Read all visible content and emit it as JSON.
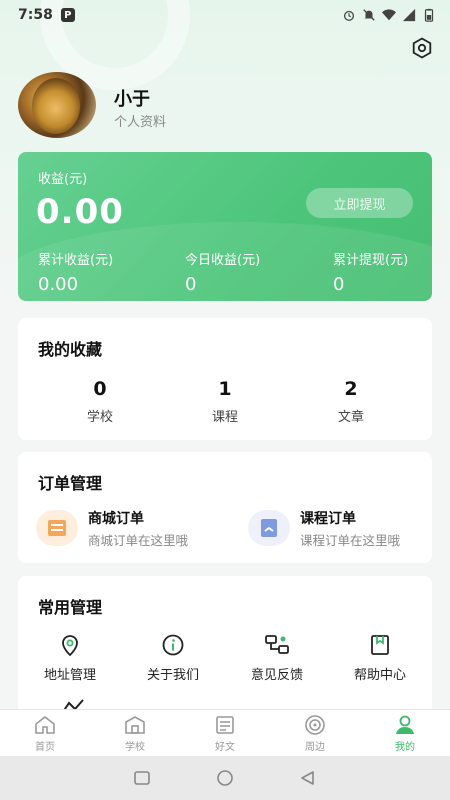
{
  "status_bar": {
    "time": "7:58",
    "app_badge": "P"
  },
  "colors": {
    "accent": "#3dbb6b",
    "card_green": "#4cc57a",
    "order_orange": "#f5a65b",
    "order_blue": "#7f9be0"
  },
  "profile": {
    "name": "小于",
    "subtitle": "个人资料"
  },
  "earnings": {
    "label": "收益(元)",
    "amount": "0.00",
    "withdraw_label": "立即提现",
    "stats": [
      {
        "label": "累计收益(元)",
        "value": "0.00"
      },
      {
        "label": "今日收益(元)",
        "value": "0"
      },
      {
        "label": "累计提现(元)",
        "value": "0"
      }
    ]
  },
  "favorites": {
    "title": "我的收藏",
    "items": [
      {
        "count": "0",
        "label": "学校"
      },
      {
        "count": "1",
        "label": "课程"
      },
      {
        "count": "2",
        "label": "文章"
      }
    ]
  },
  "orders": {
    "title": "订单管理",
    "items": [
      {
        "title": "商城订单",
        "subtitle": "商城订单在这里哦",
        "icon": "shop-order-icon"
      },
      {
        "title": "课程订单",
        "subtitle": "课程订单在这里哦",
        "icon": "course-order-icon"
      }
    ]
  },
  "tools": {
    "title": "常用管理",
    "items": [
      {
        "label": "地址管理",
        "icon": "location-icon"
      },
      {
        "label": "关于我们",
        "icon": "info-icon"
      },
      {
        "label": "意见反馈",
        "icon": "feedback-icon"
      },
      {
        "label": "帮助中心",
        "icon": "help-book-icon"
      }
    ]
  },
  "tabs": [
    {
      "label": "首页",
      "icon": "home-icon"
    },
    {
      "label": "学校",
      "icon": "school-icon"
    },
    {
      "label": "好文",
      "icon": "article-icon"
    },
    {
      "label": "周边",
      "icon": "nearby-icon"
    },
    {
      "label": "我的",
      "icon": "user-icon",
      "active": true
    }
  ]
}
